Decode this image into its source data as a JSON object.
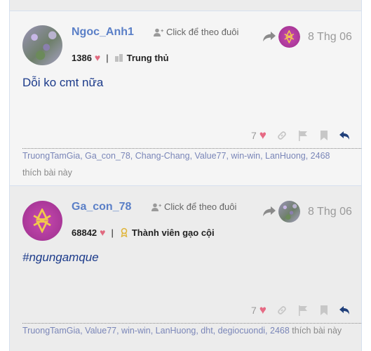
{
  "posts": [
    {
      "username": "Ngoc_Anh1",
      "follow_label": "Click để theo đuôi",
      "date": "8 Thg 06",
      "points": "1386",
      "rank": "Trung thủ",
      "content": "Dỗi ko cmt nữa",
      "like_count": "7",
      "likers": "TruongTamGia, Ga_con_78, Chang-Chang, Value77, win-win, LanHuong, 2468",
      "likers_suffix": "thích bài này"
    },
    {
      "username": "Ga_con_78",
      "follow_label": "Click để theo đuôi",
      "date": "8 Thg 06",
      "points": "68842",
      "rank": "Thành viên gạo cội",
      "content": "#ngungamque",
      "like_count": "7",
      "likers": "TruongTamGia, Value77, win-win, LanHuong, dht, degiocuondi, 2468",
      "likers_suffix": "thích bài này"
    }
  ],
  "icons": {
    "heart": "heart-icon",
    "link": "link-icon",
    "flag": "flag-icon",
    "bookmark": "bookmark-icon",
    "reply": "reply-icon"
  },
  "colors": {
    "username": "#5a7fc7",
    "content": "#1b3a8a",
    "heart": "#e66a84",
    "reply": "#1f3f7a",
    "muted_icon": "#c7c7c7"
  }
}
